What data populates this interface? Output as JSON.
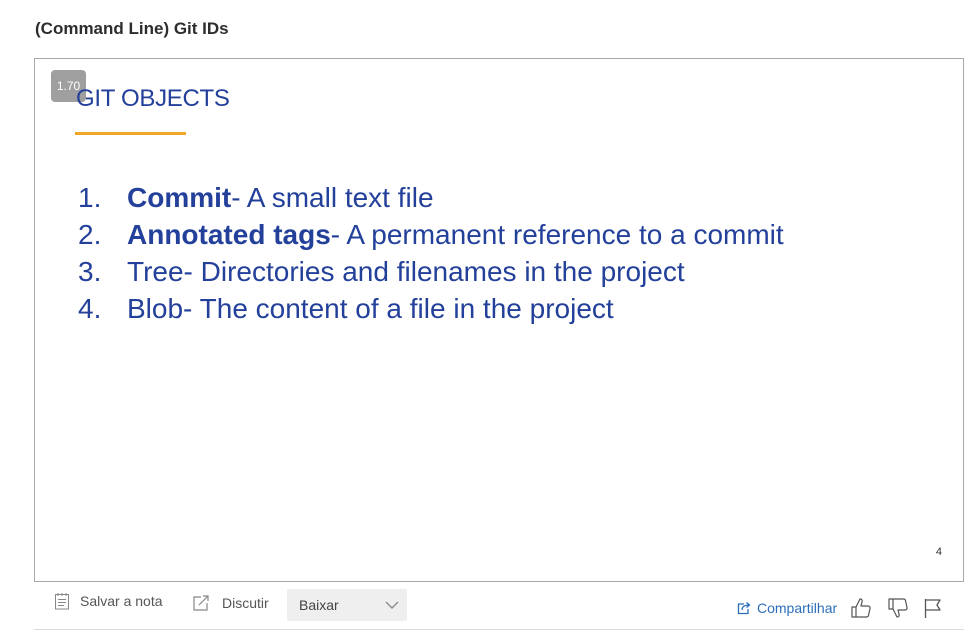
{
  "page": {
    "title": "(Command Line) Git IDs"
  },
  "slide": {
    "version_badge": "1.70",
    "heading": "GIT OBJECTS",
    "items": [
      {
        "num": "1.",
        "bold": "Commit",
        "rest": "- A small text file"
      },
      {
        "num": "2.",
        "bold": "Annotated tags",
        "rest": "- A permanent reference to a commit"
      },
      {
        "num": "3.",
        "bold": "",
        "rest": "Tree- Directories and filenames in the project"
      },
      {
        "num": "4.",
        "bold": "",
        "rest": "Blob- The content of a file in the project"
      }
    ],
    "slide_number": "4",
    "colors": {
      "text": "#23409a",
      "underline": "#f0a526"
    }
  },
  "toolbar": {
    "save_note_label": "Salvar a nota",
    "discuss_label": "Discutir",
    "download_label": "Baixar",
    "share_label": "Compartilhar",
    "icons": [
      "notepad-icon",
      "external-link-icon",
      "chevron-down-icon",
      "share-icon",
      "thumbs-up-icon",
      "thumbs-down-icon",
      "flag-icon"
    ],
    "colors": {
      "link": "#2a6ebb"
    }
  }
}
